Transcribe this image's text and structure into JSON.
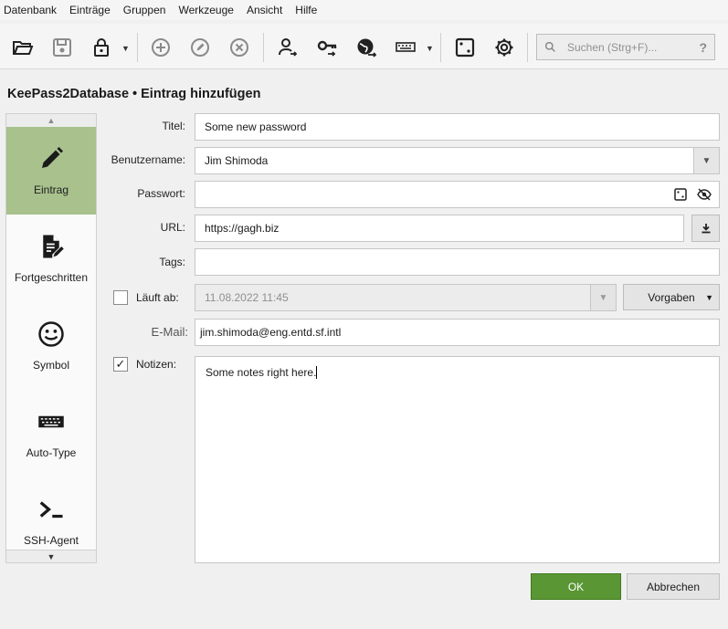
{
  "menu": [
    "Datenbank",
    "Einträge",
    "Gruppen",
    "Werkzeuge",
    "Ansicht",
    "Hilfe"
  ],
  "toolbar": {
    "icons": [
      "open-folder-icon",
      "save-icon",
      "lock-icon",
      "add-entry-icon",
      "edit-entry-icon",
      "delete-entry-icon",
      "copy-username-icon",
      "copy-password-icon",
      "open-url-icon",
      "autotype-icon",
      "password-generator-icon",
      "settings-icon"
    ],
    "search_placeholder": "Suchen (Strg+F)...",
    "search_help": "?"
  },
  "page_title": "KeePass2Database • Eintrag hinzufügen",
  "sidebar": {
    "items": [
      {
        "label": "Eintrag",
        "icon": "pencil-icon",
        "active": true
      },
      {
        "label": "Fortgeschritten",
        "icon": "document-edit-icon"
      },
      {
        "label": "Symbol",
        "icon": "smiley-icon"
      },
      {
        "label": "Auto-Type",
        "icon": "keyboard-icon"
      },
      {
        "label": "SSH-Agent",
        "icon": "terminal-icon"
      }
    ]
  },
  "form": {
    "title_label": "Titel:",
    "title_value": "Some new password",
    "username_label": "Benutzername:",
    "username_value": "Jim Shimoda",
    "password_label": "Passwort:",
    "password_value": "",
    "url_label": "URL:",
    "url_value": "https://gagh.biz",
    "tags_label": "Tags:",
    "tags_value": "",
    "expires_label": "Läuft ab:",
    "expires_checked": false,
    "expires_value": "11.08.2022 11:45",
    "presets_label": "Vorgaben",
    "email_label": "E-Mail:",
    "email_value": "jim.shimoda@eng.entd.sf.intl",
    "notes_label": "Notizen:",
    "notes_checked": true,
    "notes_checkmark": "✓",
    "notes_value": "Some notes right here."
  },
  "buttons": {
    "ok": "OK",
    "cancel": "Abbrechen"
  },
  "colors": {
    "active_sidebar": "#a8c18d",
    "ok_button": "#5a9634"
  }
}
